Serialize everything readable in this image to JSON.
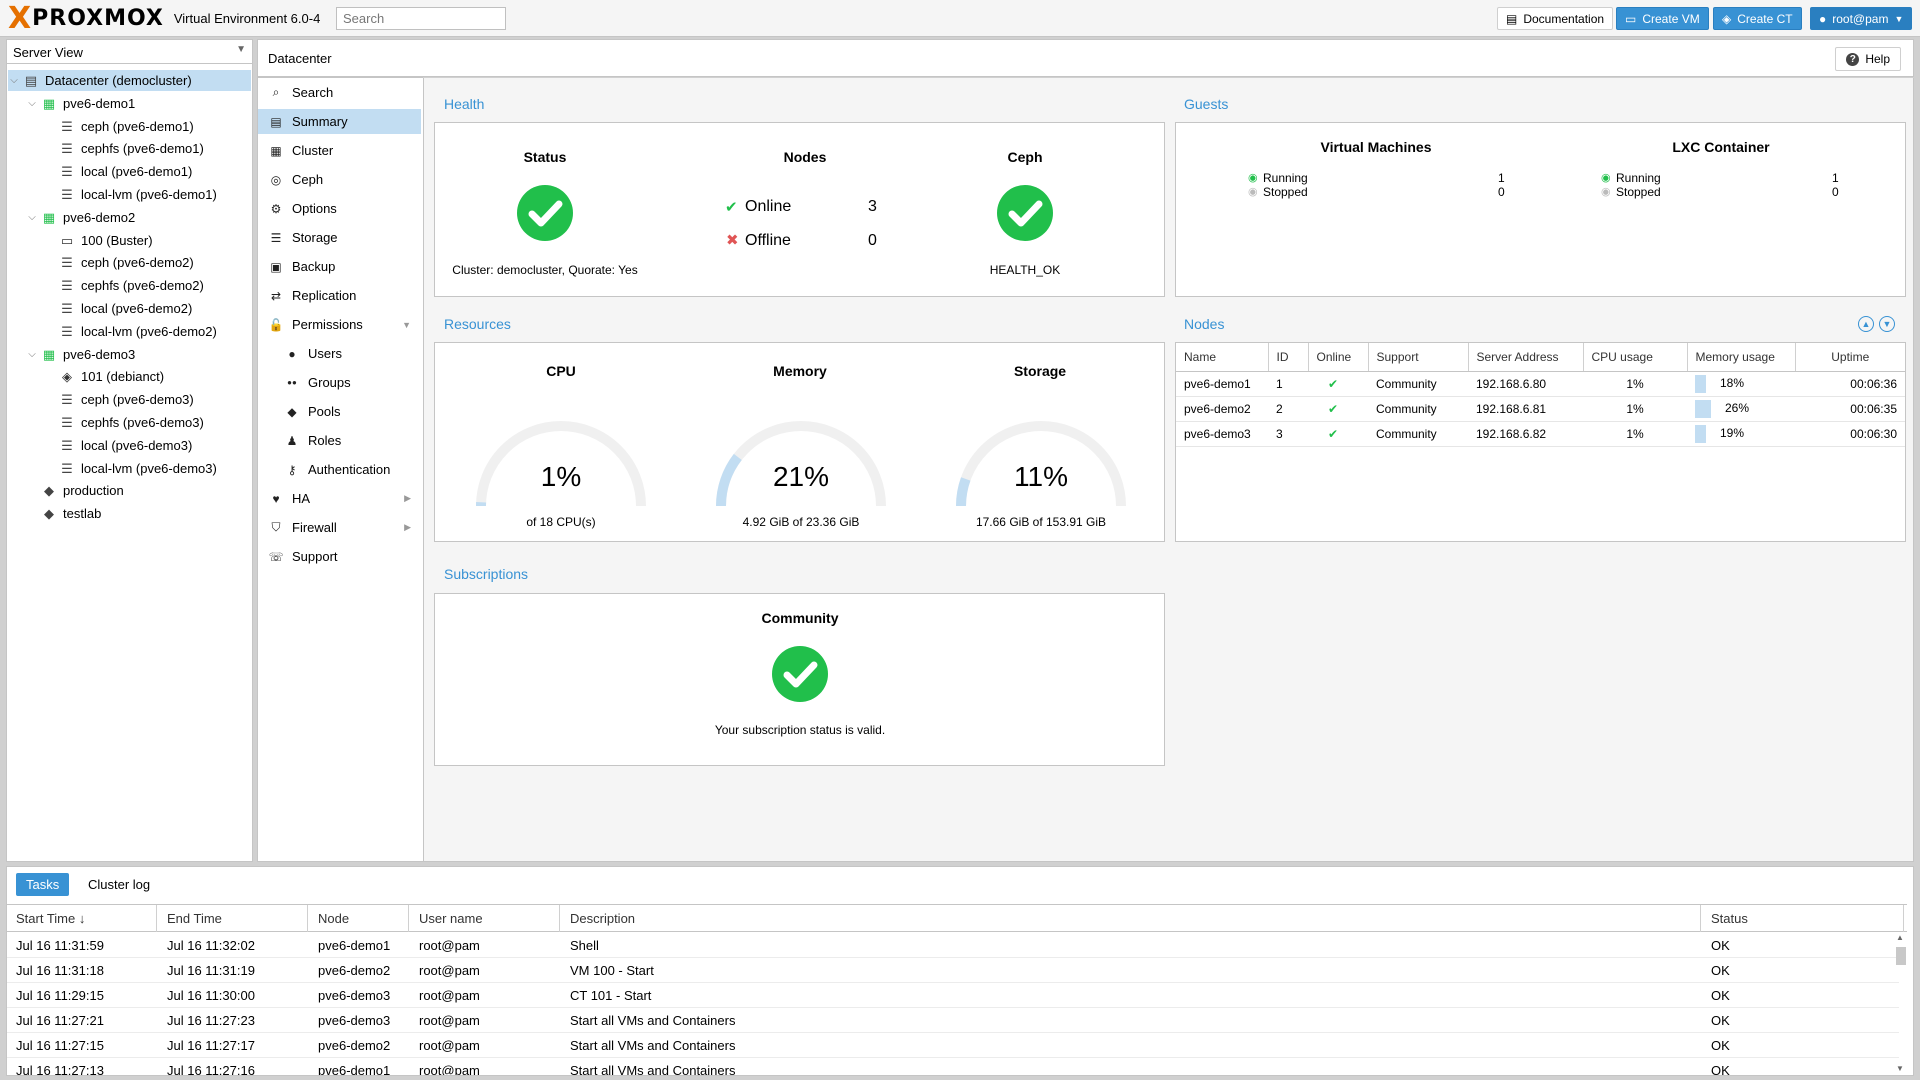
{
  "header": {
    "logo_x": "X",
    "logo_text": "PROXMOX",
    "product": "Virtual Environment 6.0-4",
    "search_placeholder": "Search",
    "documentation": "Documentation",
    "create_vm": "Create VM",
    "create_ct": "Create CT",
    "user": "root@pam"
  },
  "tree": {
    "view": "Server View",
    "items": [
      {
        "label": "Datacenter (democluster)"
      },
      {
        "label": "pve6-demo1"
      },
      {
        "label": "ceph (pve6-demo1)"
      },
      {
        "label": "cephfs (pve6-demo1)"
      },
      {
        "label": "local (pve6-demo1)"
      },
      {
        "label": "local-lvm (pve6-demo1)"
      },
      {
        "label": "pve6-demo2"
      },
      {
        "label": "100 (Buster)"
      },
      {
        "label": "ceph (pve6-demo2)"
      },
      {
        "label": "cephfs (pve6-demo2)"
      },
      {
        "label": "local (pve6-demo2)"
      },
      {
        "label": "local-lvm (pve6-demo2)"
      },
      {
        "label": "pve6-demo3"
      },
      {
        "label": "101 (debianct)"
      },
      {
        "label": "ceph (pve6-demo3)"
      },
      {
        "label": "cephfs (pve6-demo3)"
      },
      {
        "label": "local (pve6-demo3)"
      },
      {
        "label": "local-lvm (pve6-demo3)"
      },
      {
        "label": "production"
      },
      {
        "label": "testlab"
      }
    ]
  },
  "content": {
    "title": "Datacenter",
    "help": "Help"
  },
  "nav": {
    "items": [
      {
        "label": "Search"
      },
      {
        "label": "Summary"
      },
      {
        "label": "Cluster"
      },
      {
        "label": "Ceph"
      },
      {
        "label": "Options"
      },
      {
        "label": "Storage"
      },
      {
        "label": "Backup"
      },
      {
        "label": "Replication"
      },
      {
        "label": "Permissions"
      },
      {
        "label": "Users"
      },
      {
        "label": "Groups"
      },
      {
        "label": "Pools"
      },
      {
        "label": "Roles"
      },
      {
        "label": "Authentication"
      },
      {
        "label": "HA"
      },
      {
        "label": "Firewall"
      },
      {
        "label": "Support"
      }
    ]
  },
  "health": {
    "title": "Health",
    "status_label": "Status",
    "cluster_text": "Cluster: democluster, Quorate: Yes",
    "nodes_label": "Nodes",
    "online_label": "Online",
    "online_count": "3",
    "offline_label": "Offline",
    "offline_count": "0",
    "ceph_label": "Ceph",
    "ceph_status": "HEALTH_OK"
  },
  "guests": {
    "title": "Guests",
    "vm_label": "Virtual Machines",
    "vm_running_label": "Running",
    "vm_running": "1",
    "vm_stopped_label": "Stopped",
    "vm_stopped": "0",
    "ct_label": "LXC Container",
    "ct_running_label": "Running",
    "ct_running": "1",
    "ct_stopped_label": "Stopped",
    "ct_stopped": "0"
  },
  "resources": {
    "title": "Resources",
    "cpu_label": "CPU",
    "cpu_pct": "1%",
    "cpu_fraction": 0.01,
    "cpu_detail": "of 18 CPU(s)",
    "mem_label": "Memory",
    "mem_pct": "21%",
    "mem_fraction": 0.21,
    "mem_detail": "4.92 GiB of 23.36 GiB",
    "storage_label": "Storage",
    "storage_pct": "11%",
    "storage_fraction": 0.11,
    "storage_detail": "17.66 GiB of 153.91 GiB"
  },
  "nodes": {
    "title": "Nodes",
    "columns": [
      "Name",
      "ID",
      "Online",
      "Support",
      "Server Address",
      "CPU usage",
      "Memory usage",
      "Uptime"
    ],
    "rows": [
      {
        "name": "pve6-demo1",
        "id": "1",
        "support": "Community",
        "address": "192.168.6.80",
        "cpu": "1%",
        "mem": "18%",
        "mem_fraction": 0.18,
        "uptime": "00:06:36"
      },
      {
        "name": "pve6-demo2",
        "id": "2",
        "support": "Community",
        "address": "192.168.6.81",
        "cpu": "1%",
        "mem": "26%",
        "mem_fraction": 0.26,
        "uptime": "00:06:35"
      },
      {
        "name": "pve6-demo3",
        "id": "3",
        "support": "Community",
        "address": "192.168.6.82",
        "cpu": "1%",
        "mem": "19%",
        "mem_fraction": 0.19,
        "uptime": "00:06:30"
      }
    ]
  },
  "subscriptions": {
    "title": "Subscriptions",
    "level": "Community",
    "message": "Your subscription status is valid."
  },
  "tasklog": {
    "tabs": [
      "Tasks",
      "Cluster log"
    ],
    "columns": [
      "Start Time ↓",
      "End Time",
      "Node",
      "User name",
      "Description",
      "Status"
    ],
    "rows": [
      {
        "start": "Jul 16 11:31:59",
        "end": "Jul 16 11:32:02",
        "node": "pve6-demo1",
        "user": "root@pam",
        "desc": "Shell",
        "status": "OK"
      },
      {
        "start": "Jul 16 11:31:18",
        "end": "Jul 16 11:31:19",
        "node": "pve6-demo2",
        "user": "root@pam",
        "desc": "VM 100 - Start",
        "status": "OK"
      },
      {
        "start": "Jul 16 11:29:15",
        "end": "Jul 16 11:30:00",
        "node": "pve6-demo3",
        "user": "root@pam",
        "desc": "CT 101 - Start",
        "status": "OK"
      },
      {
        "start": "Jul 16 11:27:21",
        "end": "Jul 16 11:27:23",
        "node": "pve6-demo3",
        "user": "root@pam",
        "desc": "Start all VMs and Containers",
        "status": "OK"
      },
      {
        "start": "Jul 16 11:27:15",
        "end": "Jul 16 11:27:17",
        "node": "pve6-demo2",
        "user": "root@pam",
        "desc": "Start all VMs and Containers",
        "status": "OK"
      },
      {
        "start": "Jul 16 11:27:13",
        "end": "Jul 16 11:27:16",
        "node": "pve6-demo1",
        "user": "root@pam",
        "desc": "Start all VMs and Containers",
        "status": "OK"
      }
    ]
  },
  "colors": {
    "accent": "#3892d4",
    "ok_green": "#21bf4b",
    "error_red": "#e05555",
    "selection": "#c2ddf2",
    "logo_orange": "#e57000"
  }
}
